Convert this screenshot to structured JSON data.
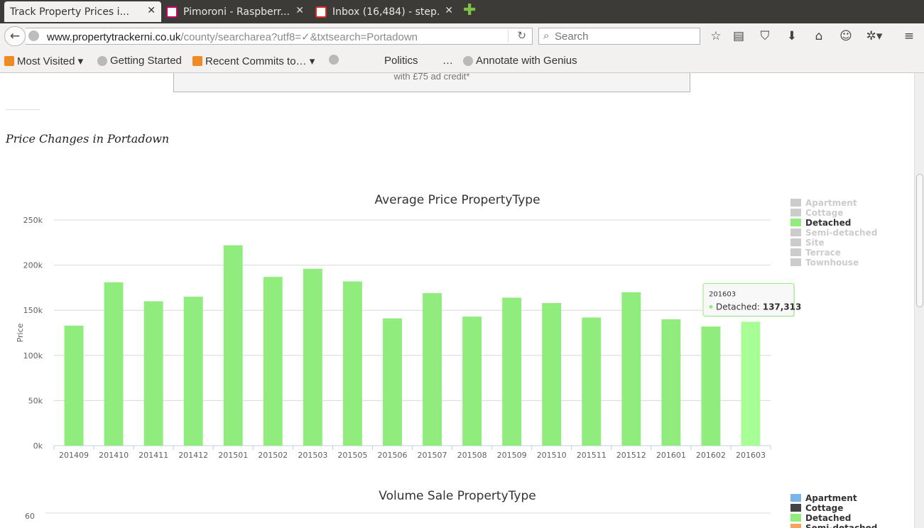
{
  "browser": {
    "tabs": [
      {
        "title": "Track Property Prices i...",
        "active": true,
        "favicon_color": "#f2f1f0"
      },
      {
        "title": "Pimoroni - Raspberr...",
        "active": false,
        "favicon_color": "#ffffff"
      },
      {
        "title": "Inbox (16,484) - step...",
        "active": false,
        "favicon_color": "#ffffff"
      }
    ],
    "close_glyph": "✕",
    "url_host": "www.propertytrackerni.co.uk",
    "url_path": "/county/searcharea?utf8=✓&txtsearch=Portadown",
    "search_placeholder": "Search",
    "bookmarks": [
      {
        "label": "Most Visited ▾"
      },
      {
        "label": "Getting Started"
      },
      {
        "label": "Recent Commits to… ▾"
      },
      {
        "label": ""
      },
      {
        "label": "Politics"
      },
      {
        "label": "…"
      },
      {
        "label": "Annotate with Genius"
      }
    ]
  },
  "page": {
    "ad_text": "with £75 ad credit*",
    "heading": "Price Changes in Portadown"
  },
  "chart_data": [
    {
      "type": "bar",
      "title": "Average Price PropertyType",
      "ylabel": "Price",
      "xlabel": "",
      "ylim": [
        0,
        250000
      ],
      "yticks": [
        "0k",
        "50k",
        "100k",
        "150k",
        "200k",
        "250k"
      ],
      "categories": [
        "201409",
        "201410",
        "201411",
        "201412",
        "201501",
        "201502",
        "201503",
        "201505",
        "201506",
        "201507",
        "201508",
        "201509",
        "201510",
        "201511",
        "201512",
        "201601",
        "201602",
        "201603"
      ],
      "series": [
        {
          "name": "Detached",
          "color": "#90ed7d",
          "values": [
            133000,
            181000,
            160000,
            165000,
            222000,
            187000,
            196000,
            182000,
            141000,
            169000,
            143000,
            164000,
            158000,
            142000,
            170000,
            140000,
            132000,
            137313
          ]
        }
      ],
      "highlight_index": 17,
      "highlight_color": "#a8ff96",
      "tooltip": {
        "category": "201603",
        "series": "Detached",
        "value": "137,313"
      },
      "legend": {
        "position": "right",
        "items": [
          {
            "label": "Apartment",
            "active": false
          },
          {
            "label": "Cottage",
            "active": false
          },
          {
            "label": "Detached",
            "active": true
          },
          {
            "label": "Semi-detached",
            "active": false
          },
          {
            "label": "Site",
            "active": false
          },
          {
            "label": "Terrace",
            "active": false
          },
          {
            "label": "Townhouse",
            "active": false
          }
        ],
        "inactive_color": "#cccccc",
        "active_color": "#333333"
      }
    },
    {
      "type": "bar",
      "title": "Volume Sale PropertyType",
      "yticks": [
        "60"
      ],
      "legend": {
        "position": "right",
        "items": [
          {
            "label": "Apartment",
            "color": "#7cb5ec"
          },
          {
            "label": "Cottage",
            "color": "#434348"
          },
          {
            "label": "Detached",
            "color": "#90ed7d"
          },
          {
            "label": "Semi-detached",
            "color": "#f7a35c"
          }
        ]
      }
    }
  ]
}
